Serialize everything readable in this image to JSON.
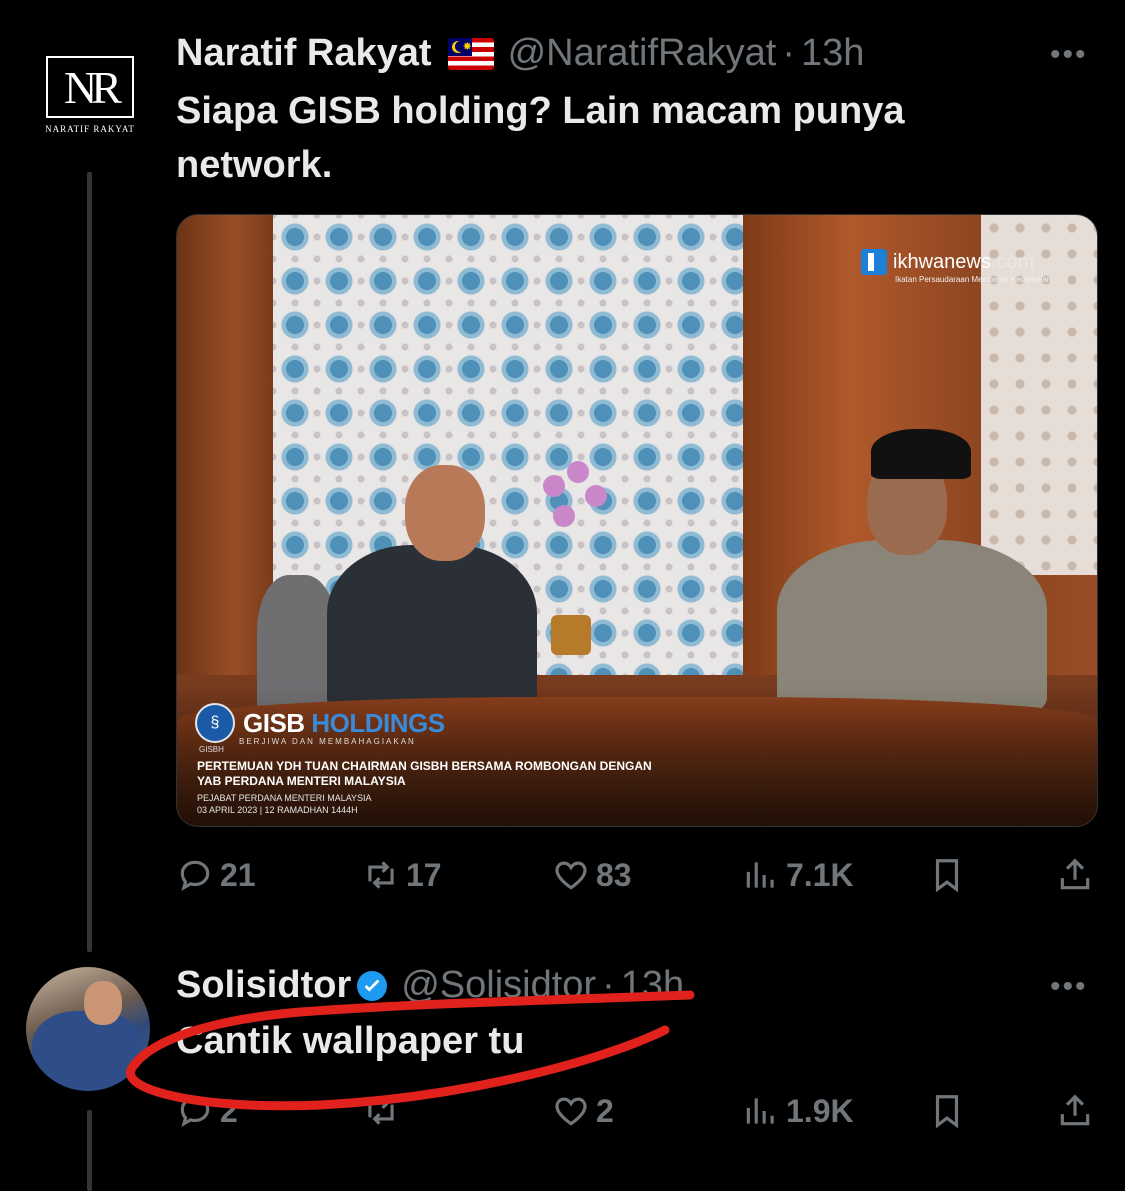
{
  "tweet1": {
    "avatar_monogram": "NR",
    "avatar_caption": "NARATIF RAKYAT",
    "display_name": "Naratif Rakyat",
    "flag_icon": "malaysia-flag-icon",
    "handle": "@NaratifRakyat",
    "separator": "·",
    "time": "13h",
    "more_label": "•••",
    "text": "Siapa GISB holding? Lain macam punya network.",
    "media": {
      "watermark_site": "ikhwanews",
      "watermark_tld": ".com",
      "watermark_tagline": "Ikatan Persaudaraan Membawa Kedamaian",
      "logo_initials": "GISBH",
      "brand_part1": "GISB",
      "brand_part2": "HOLDINGS",
      "brand_tagline": "BERJIWA DAN MEMBAHAGIAKAN",
      "caption_line1": "PERTEMUAN YDH TUAN CHAIRMAN GISBH BERSAMA ROMBONGAN DENGAN",
      "caption_line2": "YAB PERDANA MENTERI MALAYSIA",
      "caption_place": "PEJABAT PERDANA MENTERI MALAYSIA",
      "caption_date": "03 APRIL 2023 | 12 RAMADHAN 1444H"
    },
    "actions": {
      "replies": "21",
      "reposts": "17",
      "likes": "83",
      "views": "7.1K"
    }
  },
  "tweet2": {
    "display_name": "Solisidtor",
    "handle": "@Solisidtor",
    "separator": "·",
    "time": "13h",
    "more_label": "•••",
    "text": "Cantik wallpaper tu",
    "actions": {
      "replies": "2",
      "reposts": "",
      "likes": "2",
      "views": "1.9K"
    }
  },
  "colors": {
    "background": "#000000",
    "text_primary": "#e7e9ea",
    "text_secondary": "#71767b",
    "verified": "#1d9bf0",
    "annotation_stroke": "#e0211c"
  }
}
